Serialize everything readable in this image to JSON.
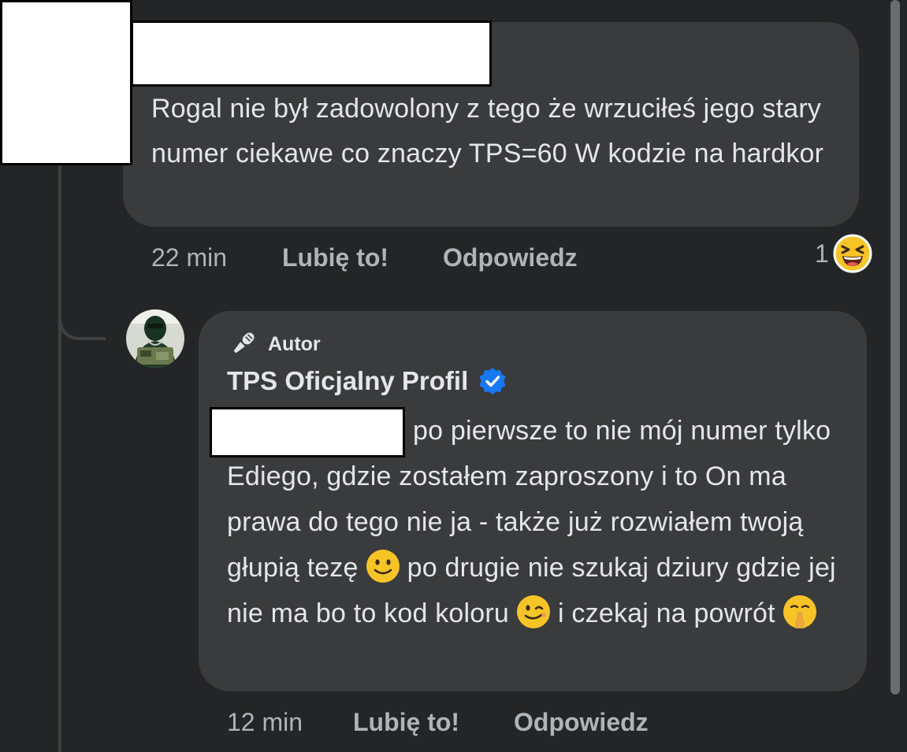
{
  "comment": {
    "text": "Rogal nie był zadowolony z tego że wrzuciłeś jego stary numer ciekawe co znaczy TPS=60 W kodzie na hardkor",
    "time": "22 min",
    "like_label": "Lubię to!",
    "reply_label": "Odpowiedz",
    "reaction_count": "1",
    "reaction_icon": "laughing-emoji"
  },
  "reply": {
    "badge_label": "Autor",
    "badge_icon": "microphone-icon",
    "author_name": "TPS Oficjalny Profil",
    "verified_icon": "verified-badge-icon",
    "text_part1": "po pierwsze to nie mój numer tylko Ediego, gdzie zostałem zaproszony i to On ma prawa do tego nie ja - także już rozwiałem twoją głupią tezę",
    "text_part2": "po drugie nie szukaj dziury gdzie jej nie ma bo to kod koloru",
    "text_part3": "i czekaj na powrót",
    "emoji_1": "slightly-smiling-face",
    "emoji_2": "winking-face",
    "emoji_3": "shushing-face",
    "time": "12 min",
    "like_label": "Lubię to!",
    "reply_label": "Odpowiedz"
  },
  "colors": {
    "background": "#242526",
    "bubble": "#3a3b3c",
    "text": "#e4e6eb",
    "meta_text": "#b0b3b8",
    "verified_blue": "#1877f2",
    "emoji_yellow": "#f7c427"
  }
}
